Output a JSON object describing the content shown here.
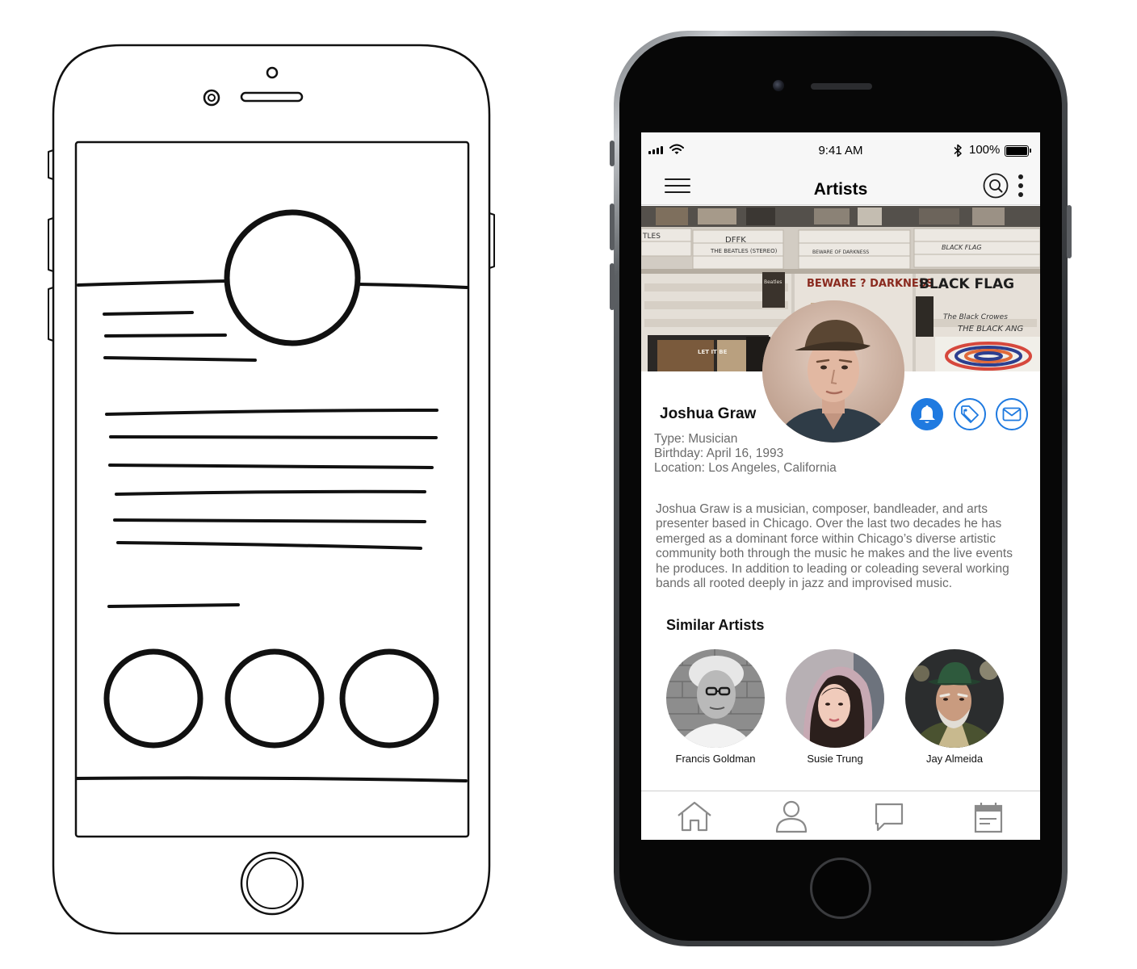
{
  "status_bar": {
    "time": "9:41 AM",
    "battery_percent": "100%",
    "battery_level": 1.0
  },
  "nav": {
    "title": "Artists",
    "left_icon": "hamburger-menu-icon",
    "right_icons": [
      "search-icon",
      "more-vertical-icon"
    ]
  },
  "cover": {
    "sleeve_texts": [
      "TLES",
      "DFFK",
      "THE BEATLES (STEREO)",
      "BEWARE OF DARKNESS",
      "BEWARE ? DARKNESS",
      "BLACK FLAG",
      "BLACK FLAG",
      "The Black Crowes",
      "THE BLACK ANG",
      "LET IT BE",
      "Beatles"
    ]
  },
  "profile": {
    "name": "Joshua Graw",
    "type": "Type: Musician",
    "birthday": "Birthday: April 16, 1993",
    "location": "Location: Los Angeles, California",
    "actions": [
      "bell-icon",
      "tag-icon",
      "mail-icon"
    ],
    "bio": "Joshua Graw is a musician, composer, bandleader, and arts presenter based in Chicago. Over the last two decades he has emerged as a dominant force within Chicago’s diverse artistic community both through the music he makes and the live events he produces. In addition to leading or coleading several working bands all rooted deeply in jazz and improvised music."
  },
  "similar": {
    "title": "Similar Artists",
    "artists": [
      {
        "name": "Francis Goldman"
      },
      {
        "name": "Susie Trung"
      },
      {
        "name": "Jay Almeida"
      }
    ]
  },
  "tabbar": {
    "tabs": [
      "home-icon",
      "profile-icon",
      "chat-icon",
      "calendar-icon"
    ]
  },
  "colors": {
    "accent": "#1f7ae0",
    "text_primary": "#111111",
    "text_secondary": "#6b6b6b",
    "bar_background": "#f7f7f7",
    "phone_body": "#070707"
  }
}
